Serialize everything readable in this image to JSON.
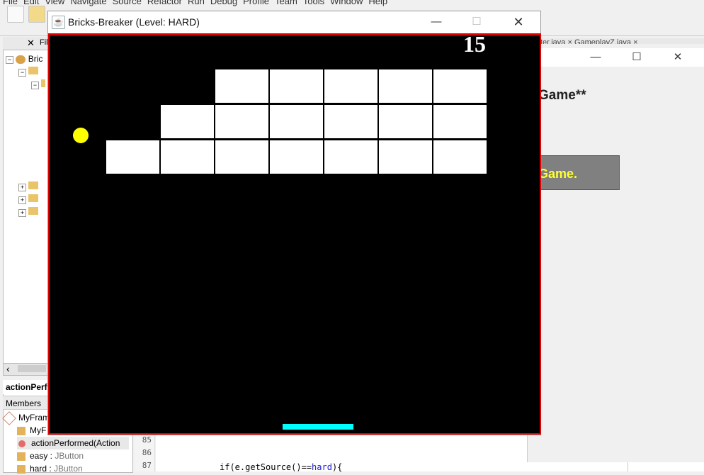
{
  "ide": {
    "menu": [
      "File",
      "Edit",
      "View",
      "Navigate",
      "Source",
      "Refactor",
      "Run",
      "Debug",
      "Profile",
      "Team",
      "Tools",
      "Window",
      "Help"
    ],
    "files_tab": "Fil",
    "project_label": "Bric",
    "navigator_title": "actionPerfo",
    "members_label": "Members",
    "members": [
      {
        "name": "MyFram",
        "type": ""
      },
      {
        "name": "MyF",
        "type": ""
      },
      {
        "name": "actionPerformed(Action",
        "type": ""
      },
      {
        "name": "easy : ",
        "type": "JButton"
      },
      {
        "name": "hard : ",
        "type": "JButton"
      }
    ],
    "line_numbers": [
      "85",
      "86",
      "87"
    ],
    "code": {
      "pre": "if(e.getSource()==",
      "kw": "hard",
      "post": "){"
    },
    "editor_tabs": "...arter.java  ×  GameplayZ.java  ×"
  },
  "menu_window": {
    "heading": "Game**",
    "button_label": "Game."
  },
  "game_window": {
    "title": "Bricks-Breaker (Level: HARD)",
    "score": "15",
    "colors": {
      "border": "#e00000",
      "ball": "#ffff00",
      "paddle": "#00ffff",
      "brick": "#ffffff",
      "background": "#000000"
    },
    "bricks": {
      "rows": [
        [
          false,
          false,
          true,
          true,
          true,
          true,
          true
        ],
        [
          false,
          true,
          true,
          true,
          true,
          true,
          true
        ],
        [
          true,
          true,
          true,
          true,
          true,
          true,
          true
        ]
      ]
    }
  },
  "icons": {
    "minimize": "—",
    "maximize": "☐",
    "close": "✕"
  }
}
